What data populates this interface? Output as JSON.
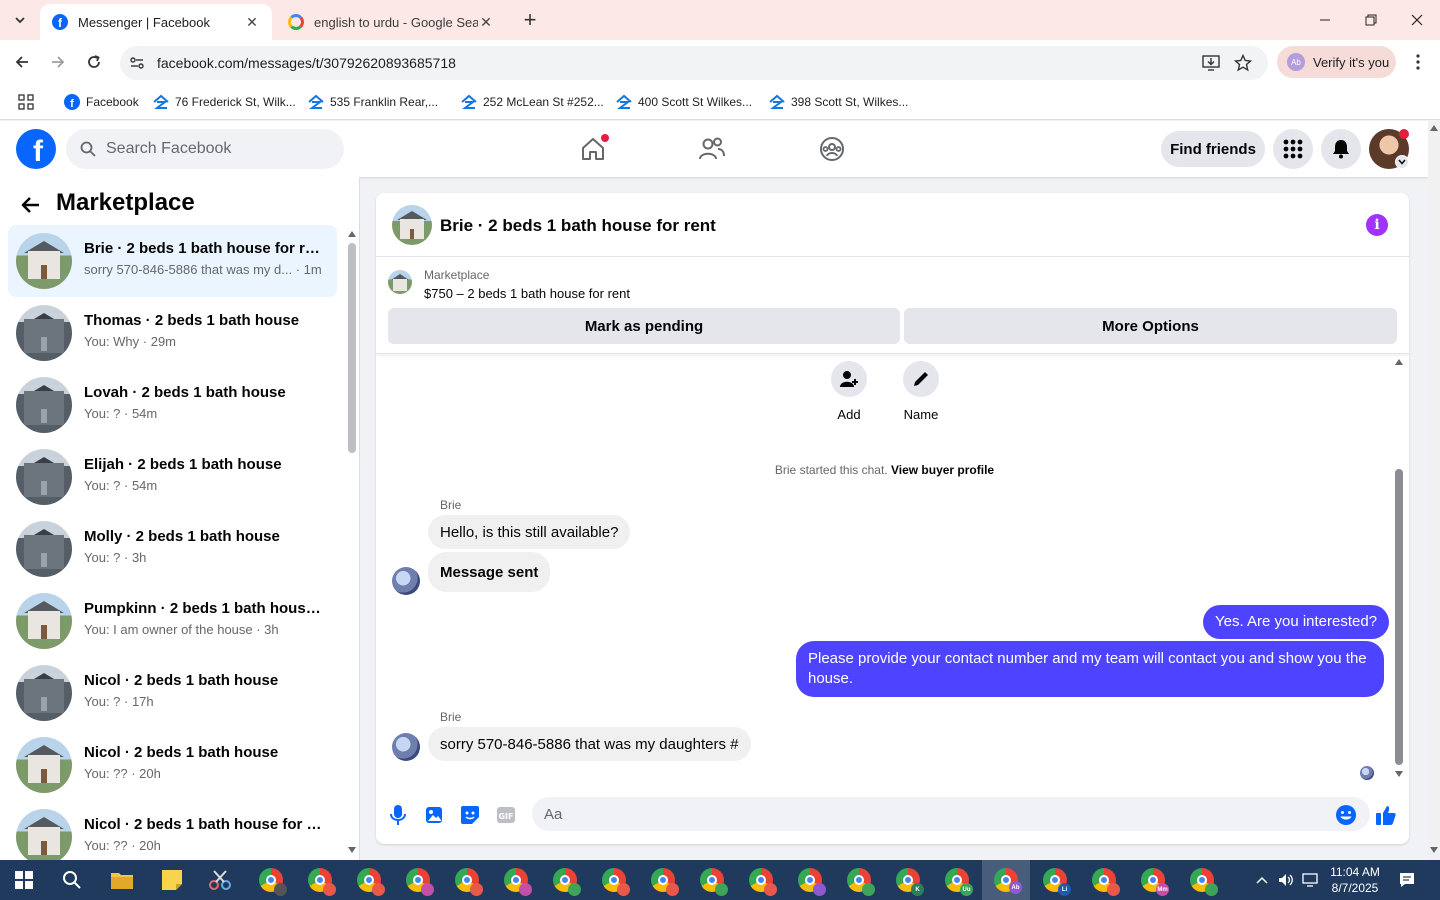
{
  "browser": {
    "tabs": [
      {
        "title": "Messenger | Facebook",
        "active": true,
        "icon": "facebook-icon"
      },
      {
        "title": "english to urdu - Google Search",
        "active": false,
        "icon": "google-icon"
      }
    ],
    "url": "facebook.com/messages/t/30792620893685718",
    "verify_chip": "Verify it's you",
    "verify_avatar": "Ab",
    "bookmarks": [
      {
        "label": "Facebook",
        "icon": "facebook-icon"
      },
      {
        "label": "76 Frederick St, Wilk...",
        "icon": "zillow-icon"
      },
      {
        "label": "535 Franklin Rear,...",
        "icon": "zillow-icon"
      },
      {
        "label": "252 McLean St #252...",
        "icon": "zillow-icon"
      },
      {
        "label": "400 Scott St Wilkes...",
        "icon": "zillow-icon"
      },
      {
        "label": "398 Scott St, Wilkes...",
        "icon": "zillow-icon"
      }
    ]
  },
  "facebook": {
    "search_placeholder": "Search Facebook",
    "find_friends": "Find friends"
  },
  "sidebar": {
    "title": "Marketplace",
    "conversations": [
      {
        "title": "Brie · 2 beds 1 bath house for rent",
        "subtitle": "sorry 570-846-5886 that was my d... · 1m",
        "active": true,
        "thumb": "white-house"
      },
      {
        "title": "Thomas · 2 beds 1 bath house",
        "subtitle": "You: Why · 29m",
        "active": false,
        "thumb": "grey-house"
      },
      {
        "title": "Lovah · 2 beds 1 bath house",
        "subtitle": "You: ? · 54m",
        "active": false,
        "thumb": "grey-house"
      },
      {
        "title": "Elijah · 2 beds 1 bath house",
        "subtitle": "You: ? · 54m",
        "active": false,
        "thumb": "grey-house"
      },
      {
        "title": "Molly · 2 beds 1 bath house",
        "subtitle": "You: ? · 3h",
        "active": false,
        "thumb": "grey-house"
      },
      {
        "title": "Pumpkinn · 2 beds 1 bath house ...",
        "subtitle": "You: I am owner of the house · 3h",
        "active": false,
        "thumb": "white-house"
      },
      {
        "title": "Nicol · 2 beds 1 bath house",
        "subtitle": "You: ? · 17h",
        "active": false,
        "thumb": "grey-house"
      },
      {
        "title": "Nicol · 2 beds 1 bath house",
        "subtitle": "You: ?? · 20h",
        "active": false,
        "thumb": "white-house"
      },
      {
        "title": "Nicol · 2 beds 1 bath house for r...",
        "subtitle": "You: ?? · 20h",
        "active": false,
        "thumb": "white-house"
      }
    ]
  },
  "chat": {
    "title": "Brie · 2 beds 1 bath house for rent",
    "listing_label": "Marketplace",
    "listing_price": "$750 – 2 beds 1 bath house for rent",
    "mark_pending": "Mark as pending",
    "more_options": "More Options",
    "actions": [
      {
        "label": "Add",
        "icon": "add-person-icon"
      },
      {
        "label": "Name",
        "icon": "pencil-icon"
      }
    ],
    "system_message": "Brie started this chat.",
    "system_link": "View buyer profile",
    "messages": [
      {
        "sender": "Brie",
        "text": "Hello, is this still available?",
        "direction": "in"
      },
      {
        "sender": "",
        "text": "Message sent",
        "direction": "in"
      },
      {
        "sender": "",
        "text": "Yes. Are you interested?",
        "direction": "out"
      },
      {
        "sender": "",
        "text": "Please provide your contact number  and my team will contact you and show you the house.",
        "direction": "out"
      },
      {
        "sender": "Brie",
        "text": "sorry 570-846-5886 that was my daughters #",
        "direction": "in"
      }
    ],
    "composer_placeholder": "Aa"
  },
  "taskbar": {
    "time": "11:04 AM",
    "date": "8/7/2025",
    "badges": [
      "K",
      "Uu",
      "Ab",
      "Li",
      "Mm"
    ]
  },
  "colors": {
    "fb_blue": "#0866ff",
    "outgoing_bubble": "#4e44ff",
    "incoming_bubble": "#f0f0f0",
    "info_purple": "#a033ff",
    "tab_strip": "#fce8e6"
  }
}
